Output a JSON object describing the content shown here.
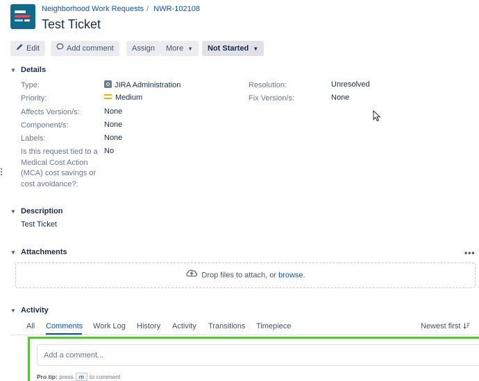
{
  "header": {
    "project_name": "Neighborhood Work Requests",
    "breadcrumb_separator": "/",
    "issue_key": "NWR-102108",
    "title": "Test Ticket"
  },
  "toolbar": {
    "edit": "Edit",
    "add_comment": "Add comment",
    "assign": "Assign",
    "more": "More",
    "status": "Not Started"
  },
  "details": {
    "heading": "Details",
    "left": [
      {
        "label": "Type:",
        "value": "JIRA Administration",
        "icon": "issuetype-icon"
      },
      {
        "label": "Priority:",
        "value": "Medium",
        "icon": "priority-medium-icon"
      },
      {
        "label": "Affects Version/s:",
        "value": "None"
      },
      {
        "label": "Component/s:",
        "value": "None"
      },
      {
        "label": "Labels:",
        "value": "None"
      },
      {
        "label": "Is this request tied to a Medical Cost Action (MCA) cost savings or cost avoidance?:",
        "value": "No"
      }
    ],
    "right": [
      {
        "label": "Resolution:",
        "value": "Unresolved"
      },
      {
        "label": "Fix Version/s:",
        "value": "None"
      }
    ]
  },
  "description": {
    "heading": "Description",
    "text": "Test Ticket"
  },
  "attachments": {
    "heading": "Attachments",
    "more": "•••",
    "drop_text": "Drop files to attach, or",
    "browse": "browse."
  },
  "activity": {
    "heading": "Activity",
    "tabs": [
      "All",
      "Comments",
      "Work Log",
      "History",
      "Activity",
      "Transitions",
      "Timepiece"
    ],
    "active_tab": "Comments",
    "sort": "Newest first",
    "comment_placeholder": "Add a comment...",
    "protip_label": "Pro tip:",
    "protip_pre": "press",
    "protip_key": "m",
    "protip_post": "to comment"
  },
  "colors": {
    "link": "#0052cc",
    "highlight": "#5fbf3f",
    "priority_medium": "#ffab00",
    "project_avatar": "#0f6b8a"
  }
}
